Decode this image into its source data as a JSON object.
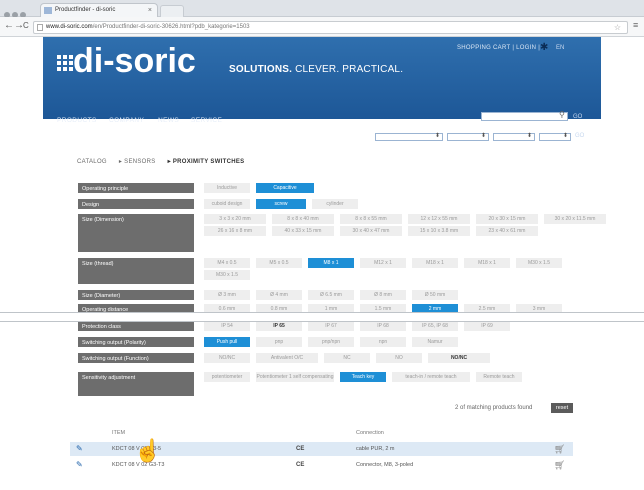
{
  "browser": {
    "tab_title": "Productfinder - di-soric",
    "tab_close": "×",
    "back": "←",
    "forward": "→",
    "reload": "C",
    "url_domain": "www.di-soric.com",
    "url_path": "/en/Productfinder-di-soric-30626.html?pdb_kategorie=1503",
    "menu_icon": "≡",
    "star_icon": "☆"
  },
  "header": {
    "logo_text": "di-soric",
    "slogan_bold": "SOLUTIONS.",
    "slogan_rest": " CLEVER. PRACTICAL.",
    "top_links": "SHOPPING CART  |  LOGIN  |",
    "lang": "EN",
    "nav": [
      "PRODUCTS",
      "COMPANY",
      "NEWS",
      "SERVICE"
    ],
    "go": "GO",
    "accent_color": "#1e8fd6",
    "header_color": "#2563a3"
  },
  "breadcrumb": {
    "catalog": "CATALOG",
    "sensors": "▸ SENSORS",
    "proximity": "▸ PROXIMITY SWITCHES"
  },
  "filters": [
    {
      "label": "Operating principle",
      "options": [
        {
          "t": "Inductive"
        },
        {
          "t": "Capacitive",
          "sel": true
        }
      ]
    },
    {
      "label": "Design",
      "options": [
        {
          "t": "cuboid design"
        },
        {
          "t": "screw",
          "sel": true
        },
        {
          "t": "cylinder"
        }
      ]
    },
    {
      "label": "Size (Dimension)",
      "options": [
        {
          "t": "3 x 3 x 20 mm"
        },
        {
          "t": "8 x 8 x 40 mm"
        },
        {
          "t": "8 x 8 x 55 mm"
        },
        {
          "t": "12 x 12 x 55 mm"
        },
        {
          "t": "20 x 30 x 15 mm"
        },
        {
          "t": "30 x 20 x 11.5 mm"
        },
        {
          "t": "26 x 16 x 8 mm"
        },
        {
          "t": "40 x 33 x 15 mm"
        },
        {
          "t": "30 x 40 x 47 mm"
        },
        {
          "t": "15 x 10 x 3.8 mm"
        },
        {
          "t": "23 x 40 x 61 mm"
        }
      ]
    },
    {
      "label": "Size (thread)",
      "options": [
        {
          "t": "M4 x 0.5"
        },
        {
          "t": "M5 x 0.5"
        },
        {
          "t": "M8 x 1",
          "sel": true
        },
        {
          "t": "M12 x 1"
        },
        {
          "t": "M18 x 1"
        },
        {
          "t": "M18 x 1"
        },
        {
          "t": "M30 x 1.5"
        },
        {
          "t": "M30 x 1.5"
        }
      ]
    },
    {
      "label": "Size (Diameter)",
      "options": [
        {
          "t": "Ø 3 mm"
        },
        {
          "t": "Ø 4 mm"
        },
        {
          "t": "Ø 6.5 mm"
        },
        {
          "t": "Ø 8 mm"
        },
        {
          "t": "Ø 50 mm"
        }
      ]
    },
    {
      "label": "Operating distance",
      "options": [
        {
          "t": "0.6 mm"
        },
        {
          "t": "0.8 mm"
        },
        {
          "t": "1 mm"
        },
        {
          "t": "1.5 mm"
        },
        {
          "t": "2 mm",
          "sel": true
        },
        {
          "t": "2.5 mm"
        },
        {
          "t": "3 mm"
        }
      ]
    },
    {
      "label": "Protection class",
      "options": [
        {
          "t": "IP 54"
        },
        {
          "t": "IP 65",
          "dk": true
        },
        {
          "t": "IP 67"
        },
        {
          "t": "IP 68"
        },
        {
          "t": "IP 65, IP 68"
        },
        {
          "t": "IP 69"
        }
      ]
    },
    {
      "label": "Switching output (Polarity)",
      "options": [
        {
          "t": "Push pull",
          "sel": true
        },
        {
          "t": "pnp"
        },
        {
          "t": "pnp/npn"
        },
        {
          "t": "npn"
        },
        {
          "t": "Namur"
        }
      ]
    },
    {
      "label": "Switching output (Function)",
      "options": [
        {
          "t": "NO/NC"
        },
        {
          "t": "Antivalent O/C"
        },
        {
          "t": "NC"
        },
        {
          "t": "NO"
        },
        {
          "t": "NO/NC",
          "dk": true
        }
      ]
    },
    {
      "label": "Sensitivity adjustment",
      "options": [
        {
          "t": "potentiometer"
        },
        {
          "t": "Potentiometer 1 self compensating"
        },
        {
          "t": "Teach key",
          "sel": true
        },
        {
          "t": "teach-in / remote teach"
        },
        {
          "t": "Remote teach"
        }
      ]
    }
  ],
  "results": {
    "match_text": "2 of matching products found",
    "reset_label": "reset",
    "col_item": "ITEM",
    "col_connection": "Connection",
    "rows": [
      {
        "item": "KDCT 08 V 02 G3-5",
        "ce": "CE",
        "connection": "cable PUR, 2 m"
      },
      {
        "item": "KDCT 08 V 02 G3-T3",
        "ce": "CE",
        "connection": "Connector, M8, 3-poled"
      }
    ]
  }
}
